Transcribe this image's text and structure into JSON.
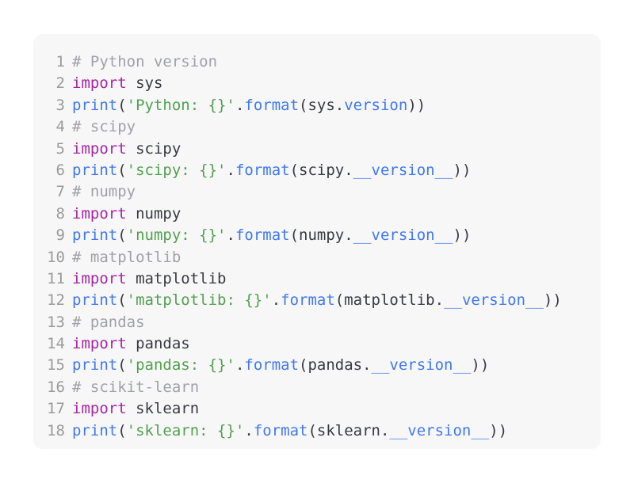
{
  "colors": {
    "background": "#ffffff",
    "code_background": "#f7f7f7",
    "line_number": "#9a9a9a",
    "keyword": "#a626a4",
    "function": "#4078f2",
    "string": "#50a14f",
    "comment": "#a0a1a7",
    "plain": "#383a42"
  },
  "lines": [
    {
      "n": "1",
      "tokens": [
        {
          "t": "# Python version",
          "c": "cm"
        }
      ]
    },
    {
      "n": "2",
      "tokens": [
        {
          "t": "import",
          "c": "kw"
        },
        {
          "t": " sys",
          "c": "plain"
        }
      ]
    },
    {
      "n": "3",
      "tokens": [
        {
          "t": "print",
          "c": "fn"
        },
        {
          "t": "(",
          "c": "plain"
        },
        {
          "t": "'Python: {}'",
          "c": "str"
        },
        {
          "t": ".",
          "c": "plain"
        },
        {
          "t": "format",
          "c": "fn"
        },
        {
          "t": "(sys.",
          "c": "plain"
        },
        {
          "t": "version",
          "c": "fn"
        },
        {
          "t": "))",
          "c": "plain"
        }
      ]
    },
    {
      "n": "4",
      "tokens": [
        {
          "t": "# scipy",
          "c": "cm"
        }
      ]
    },
    {
      "n": "5",
      "tokens": [
        {
          "t": "import",
          "c": "kw"
        },
        {
          "t": " scipy",
          "c": "plain"
        }
      ]
    },
    {
      "n": "6",
      "tokens": [
        {
          "t": "print",
          "c": "fn"
        },
        {
          "t": "(",
          "c": "plain"
        },
        {
          "t": "'scipy: {}'",
          "c": "str"
        },
        {
          "t": ".",
          "c": "plain"
        },
        {
          "t": "format",
          "c": "fn"
        },
        {
          "t": "(scipy.",
          "c": "plain"
        },
        {
          "t": "__version__",
          "c": "fn"
        },
        {
          "t": "))",
          "c": "plain"
        }
      ]
    },
    {
      "n": "7",
      "tokens": [
        {
          "t": "# numpy",
          "c": "cm"
        }
      ]
    },
    {
      "n": "8",
      "tokens": [
        {
          "t": "import",
          "c": "kw"
        },
        {
          "t": " numpy",
          "c": "plain"
        }
      ]
    },
    {
      "n": "9",
      "tokens": [
        {
          "t": "print",
          "c": "fn"
        },
        {
          "t": "(",
          "c": "plain"
        },
        {
          "t": "'numpy: {}'",
          "c": "str"
        },
        {
          "t": ".",
          "c": "plain"
        },
        {
          "t": "format",
          "c": "fn"
        },
        {
          "t": "(numpy.",
          "c": "plain"
        },
        {
          "t": "__version__",
          "c": "fn"
        },
        {
          "t": "))",
          "c": "plain"
        }
      ]
    },
    {
      "n": "10",
      "tokens": [
        {
          "t": "# matplotlib",
          "c": "cm"
        }
      ]
    },
    {
      "n": "11",
      "tokens": [
        {
          "t": "import",
          "c": "kw"
        },
        {
          "t": " matplotlib",
          "c": "plain"
        }
      ]
    },
    {
      "n": "12",
      "tokens": [
        {
          "t": "print",
          "c": "fn"
        },
        {
          "t": "(",
          "c": "plain"
        },
        {
          "t": "'matplotlib: {}'",
          "c": "str"
        },
        {
          "t": ".",
          "c": "plain"
        },
        {
          "t": "format",
          "c": "fn"
        },
        {
          "t": "(matplotlib.",
          "c": "plain"
        },
        {
          "t": "__version__",
          "c": "fn"
        },
        {
          "t": "))",
          "c": "plain"
        }
      ]
    },
    {
      "n": "13",
      "tokens": [
        {
          "t": "# pandas",
          "c": "cm"
        }
      ]
    },
    {
      "n": "14",
      "tokens": [
        {
          "t": "import",
          "c": "kw"
        },
        {
          "t": " pandas",
          "c": "plain"
        }
      ]
    },
    {
      "n": "15",
      "tokens": [
        {
          "t": "print",
          "c": "fn"
        },
        {
          "t": "(",
          "c": "plain"
        },
        {
          "t": "'pandas: {}'",
          "c": "str"
        },
        {
          "t": ".",
          "c": "plain"
        },
        {
          "t": "format",
          "c": "fn"
        },
        {
          "t": "(pandas.",
          "c": "plain"
        },
        {
          "t": "__version__",
          "c": "fn"
        },
        {
          "t": "))",
          "c": "plain"
        }
      ]
    },
    {
      "n": "16",
      "tokens": [
        {
          "t": "# scikit-learn",
          "c": "cm"
        }
      ]
    },
    {
      "n": "17",
      "tokens": [
        {
          "t": "import",
          "c": "kw"
        },
        {
          "t": " sklearn",
          "c": "plain"
        }
      ]
    },
    {
      "n": "18",
      "tokens": [
        {
          "t": "print",
          "c": "fn"
        },
        {
          "t": "(",
          "c": "plain"
        },
        {
          "t": "'sklearn: {}'",
          "c": "str"
        },
        {
          "t": ".",
          "c": "plain"
        },
        {
          "t": "format",
          "c": "fn"
        },
        {
          "t": "(sklearn.",
          "c": "plain"
        },
        {
          "t": "__version__",
          "c": "fn"
        },
        {
          "t": "))",
          "c": "plain"
        }
      ]
    }
  ]
}
